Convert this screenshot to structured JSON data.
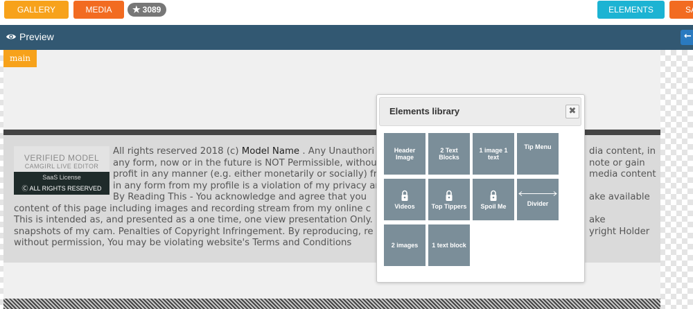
{
  "toolbar": {
    "gallery_label": "GALLERY",
    "media_label": "MEDIA",
    "stars_count": "3089",
    "elements_label": "ELEMENTS",
    "save_label": "SA"
  },
  "preview": {
    "title": "Preview",
    "back_icon": "arrow-left-icon"
  },
  "canvas": {
    "section_tag": "main",
    "badge": {
      "line1": "VERIFIED MODEL",
      "line2": "CAMGIRL LIVE EDITOR",
      "line3": "SaaS License",
      "line4": "ALL RIGHTS RESERVED"
    },
    "copyright": {
      "part1": "All rights reserved 2018 (c) ",
      "model_name": " Model Name ",
      "part2": ". Any Unauthori",
      "hidden_note": "text partially covered by dialog",
      "line_a": "dia content, in",
      "line_b": "any form, now or in the future is NOT Permissible, without",
      "line_b2": "note or gain",
      "line_c": "profit in any manner (e.g. either monetarily or socially) fr",
      "line_c2": "media content",
      "line_d": "in any form from my profile is a violation of my privacy an",
      "line_e": "By Reading This - You acknowledge and agree that you",
      "line_e2": "ake available",
      "line_f": "content of this page including images and recording stream from my online c",
      "line_g": "This is intended as, and presented as a one time, one view presentation Only.",
      "line_g2": "ake",
      "line_h": "snapshots of my cam. Penalties of Copyright Infringement. By reproducing, re",
      "line_h2": "yright Holder",
      "line_i": "without permission, You may be violating website's Terms and Conditions"
    }
  },
  "library": {
    "title": "Elements library",
    "close_icon": "close-icon",
    "tiles": [
      {
        "label": "Header Image",
        "locked": false
      },
      {
        "label": "2 Text Blocks",
        "locked": false
      },
      {
        "label": "1 image 1 text",
        "locked": false
      },
      {
        "label": "Tip Menu",
        "locked": false
      },
      {
        "label": "Videos",
        "locked": true
      },
      {
        "label": "Top Tippers",
        "locked": true
      },
      {
        "label": "Spoil Me",
        "locked": true
      },
      {
        "label": "Divider",
        "locked": false
      },
      {
        "label": "2 images",
        "locked": false
      },
      {
        "label": "1 text block",
        "locked": false
      }
    ]
  },
  "colors": {
    "gallery": "#f7a21b",
    "media": "#f26b21",
    "elements": "#1cb3d3",
    "preview_bar": "#325872",
    "tile": "#7b8e99"
  }
}
